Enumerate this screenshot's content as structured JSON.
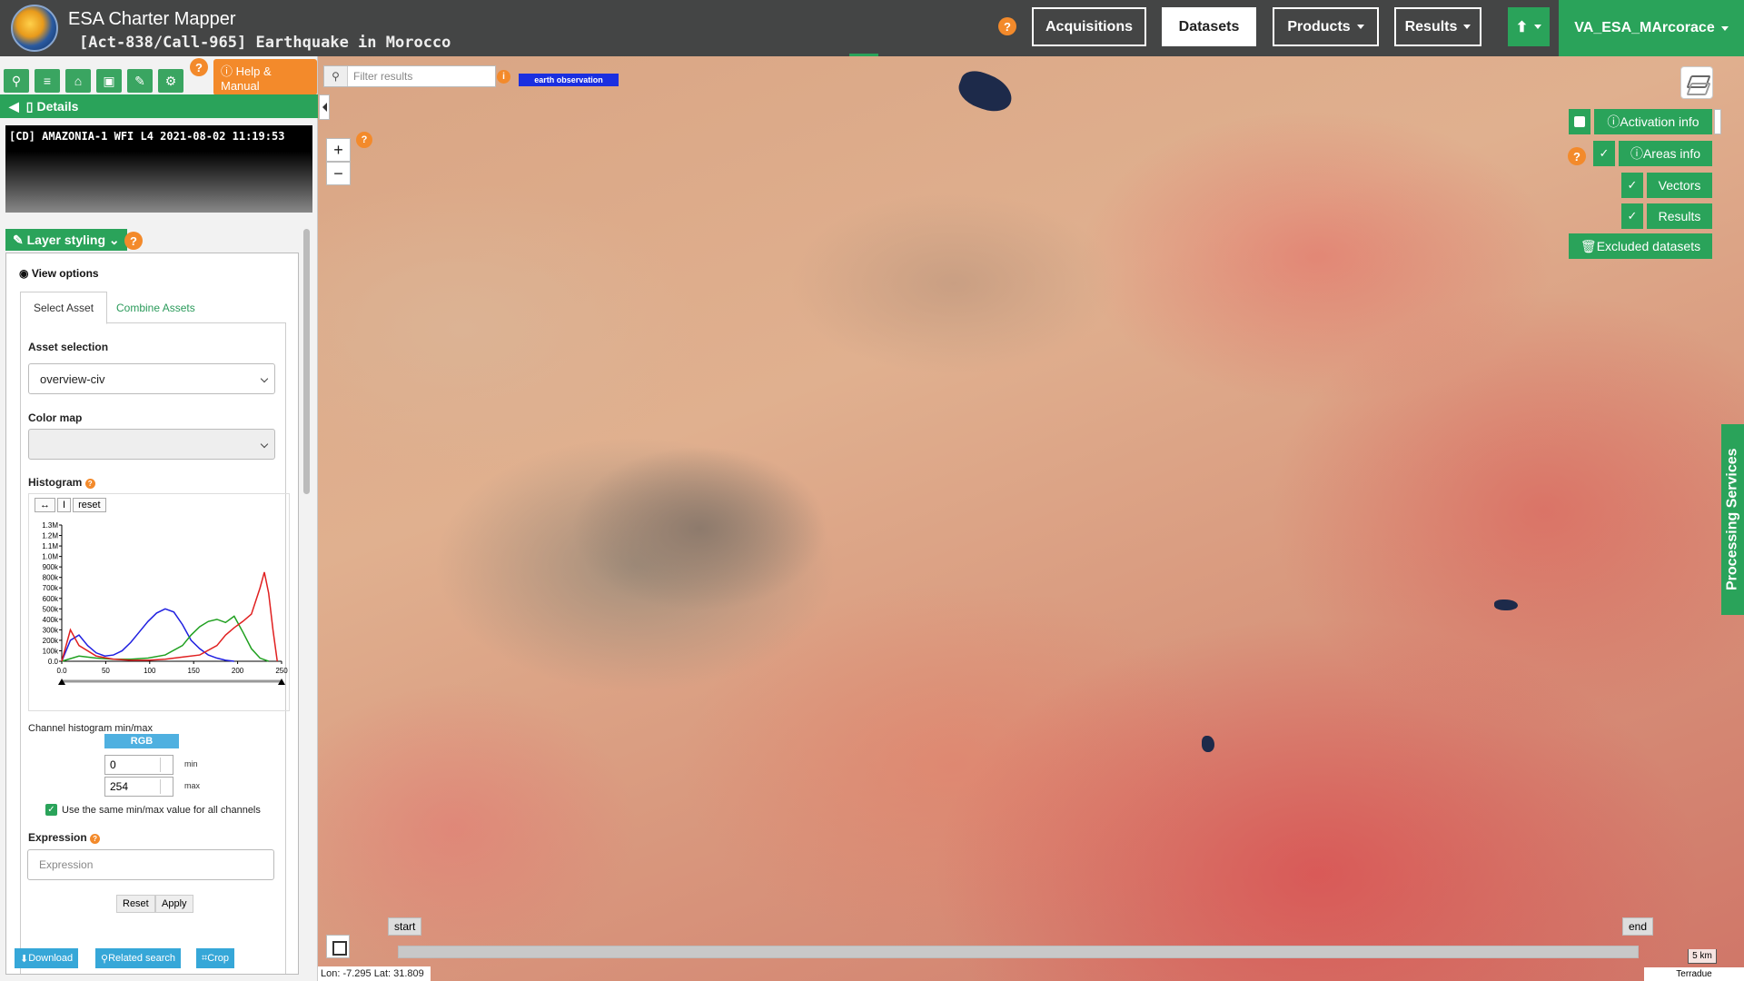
{
  "header": {
    "app_title": "ESA Charter Mapper",
    "activation": "[Act-838/Call-965] Earthquake in Morocco",
    "nav": [
      "Acquisitions",
      "Datasets",
      "Products",
      "Results"
    ],
    "active_nav": "Datasets",
    "user": "VA_ESA_MArcorace",
    "help": "?"
  },
  "sidebar": {
    "help_manual": "Help & Manual",
    "details": "Details",
    "dataset_title": "[CD] AMAZONIA-1 WFI L4 2021-08-02 11:19:53",
    "layer_styling": "Layer styling",
    "view_options": "View options",
    "tabs": [
      "Select Asset",
      "Combine Assets"
    ],
    "asset_selection_label": "Asset selection",
    "asset_selection_value": "overview-civ",
    "color_map_label": "Color map",
    "histogram_label": "Histogram",
    "hist_tools": [
      "↔",
      "I",
      "reset"
    ],
    "channel_label": "Channel histogram min/max",
    "rgb": "RGB",
    "min_value": "0",
    "max_value": "254",
    "min_lbl": "min",
    "max_lbl": "max",
    "same_minmax": "Use the same min/max value for all channels",
    "expression_label": "Expression",
    "expression_placeholder": "Expression",
    "reset": "Reset",
    "apply": "Apply",
    "bottom": [
      "Download",
      "Related search",
      "Crop"
    ]
  },
  "map": {
    "filter_placeholder": "Filter results",
    "eo_badge": "earth observation",
    "activation_info": "Activation info",
    "areas_info": "Areas info",
    "vectors": "Vectors",
    "results": "Results",
    "excluded": "Excluded datasets",
    "processing": "Processing Services",
    "start": "start",
    "end": "end",
    "scale": "5 km",
    "coords": "Lon: -7.295 Lat: 31.809",
    "attribution": "Terradue",
    "zoom_in": "+",
    "zoom_out": "−"
  },
  "chart_data": {
    "type": "line",
    "title": "",
    "yticks": [
      "0.0",
      "100k",
      "200k",
      "300k",
      "400k",
      "500k",
      "600k",
      "700k",
      "800k",
      "900k",
      "1.0M",
      "1.1M",
      "1.2M",
      "1.3M"
    ],
    "xticks": [
      "0.0",
      "50",
      "100",
      "150",
      "200",
      "250"
    ],
    "xlim": [
      0,
      255
    ],
    "ylim": [
      0,
      1300000
    ],
    "series": [
      {
        "color": "#2020e0",
        "x": [
          0,
          10,
          20,
          30,
          40,
          50,
          60,
          70,
          80,
          90,
          100,
          110,
          120,
          130,
          140,
          150,
          160,
          170,
          180,
          190,
          200
        ],
        "values": [
          0,
          200000,
          250000,
          150000,
          80000,
          50000,
          60000,
          100000,
          180000,
          280000,
          380000,
          460000,
          500000,
          470000,
          350000,
          200000,
          120000,
          60000,
          30000,
          10000,
          0
        ]
      },
      {
        "color": "#20a020",
        "x": [
          0,
          20,
          40,
          60,
          80,
          100,
          120,
          140,
          150,
          160,
          170,
          180,
          190,
          200,
          210,
          220,
          230,
          240
        ],
        "values": [
          0,
          50000,
          30000,
          20000,
          20000,
          30000,
          60000,
          150000,
          250000,
          330000,
          380000,
          400000,
          370000,
          430000,
          280000,
          120000,
          30000,
          0
        ]
      },
      {
        "color": "#e02020",
        "x": [
          0,
          10,
          20,
          40,
          60,
          80,
          100,
          120,
          140,
          160,
          180,
          190,
          200,
          210,
          220,
          230,
          235,
          240,
          245,
          250
        ],
        "values": [
          0,
          300000,
          150000,
          50000,
          20000,
          10000,
          10000,
          20000,
          40000,
          60000,
          150000,
          250000,
          320000,
          380000,
          450000,
          700000,
          850000,
          650000,
          300000,
          0
        ]
      }
    ]
  }
}
